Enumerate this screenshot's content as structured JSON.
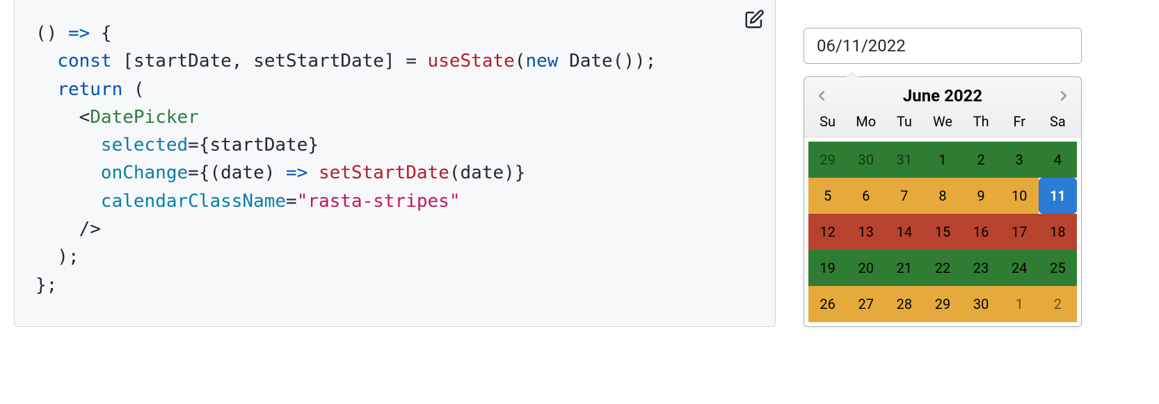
{
  "code": {
    "line1_a": "() ",
    "line1_arrow": "=>",
    "line1_b": " {",
    "line2_indent": "  ",
    "line2_const": "const",
    "line2_vars": " [startDate, setStartDate] = ",
    "line2_useState": "useState",
    "line2_paren1": "(",
    "line2_new": "new",
    "line2_space": " ",
    "line2_Date": "Date",
    "line2_end": "());",
    "line3_indent": "  ",
    "line3_return": "return",
    "line3_end": " (",
    "line4_indent": "    <",
    "line4_DatePicker": "DatePicker",
    "line5_indent": "      ",
    "line5_selected": "selected",
    "line5_eq": "=",
    "line5_val": "{startDate}",
    "line6_indent": "      ",
    "line6_onChange": "onChange",
    "line6_eq": "=",
    "line6_a": "{(date) ",
    "line6_arrow": "=>",
    "line6_space": " ",
    "line6_setStartDate": "setStartDate",
    "line6_end": "(date)}",
    "line7_indent": "      ",
    "line7_attr": "calendarClassName",
    "line7_eq": "=",
    "line7_str": "\"rasta-stripes\"",
    "line8": "    />",
    "line9": "  );",
    "line10": "};"
  },
  "input": {
    "value": "06/11/2022"
  },
  "calendar": {
    "title": "June 2022",
    "dow": [
      "Su",
      "Mo",
      "Tu",
      "We",
      "Th",
      "Fr",
      "Sa"
    ],
    "weeks": [
      {
        "stripe": "green",
        "days": [
          {
            "n": "29",
            "out": true
          },
          {
            "n": "30",
            "out": true
          },
          {
            "n": "31",
            "out": true
          },
          {
            "n": "1"
          },
          {
            "n": "2"
          },
          {
            "n": "3"
          },
          {
            "n": "4"
          }
        ]
      },
      {
        "stripe": "yellow",
        "days": [
          {
            "n": "5"
          },
          {
            "n": "6"
          },
          {
            "n": "7"
          },
          {
            "n": "8"
          },
          {
            "n": "9"
          },
          {
            "n": "10"
          },
          {
            "n": "11",
            "selected": true
          }
        ]
      },
      {
        "stripe": "red",
        "days": [
          {
            "n": "12"
          },
          {
            "n": "13"
          },
          {
            "n": "14"
          },
          {
            "n": "15"
          },
          {
            "n": "16"
          },
          {
            "n": "17"
          },
          {
            "n": "18"
          }
        ]
      },
      {
        "stripe": "green",
        "days": [
          {
            "n": "19"
          },
          {
            "n": "20"
          },
          {
            "n": "21"
          },
          {
            "n": "22"
          },
          {
            "n": "23"
          },
          {
            "n": "24"
          },
          {
            "n": "25"
          }
        ]
      },
      {
        "stripe": "yellow",
        "days": [
          {
            "n": "26"
          },
          {
            "n": "27"
          },
          {
            "n": "28"
          },
          {
            "n": "29"
          },
          {
            "n": "30"
          },
          {
            "n": "1",
            "out": true
          },
          {
            "n": "2",
            "out": true
          }
        ]
      }
    ]
  }
}
